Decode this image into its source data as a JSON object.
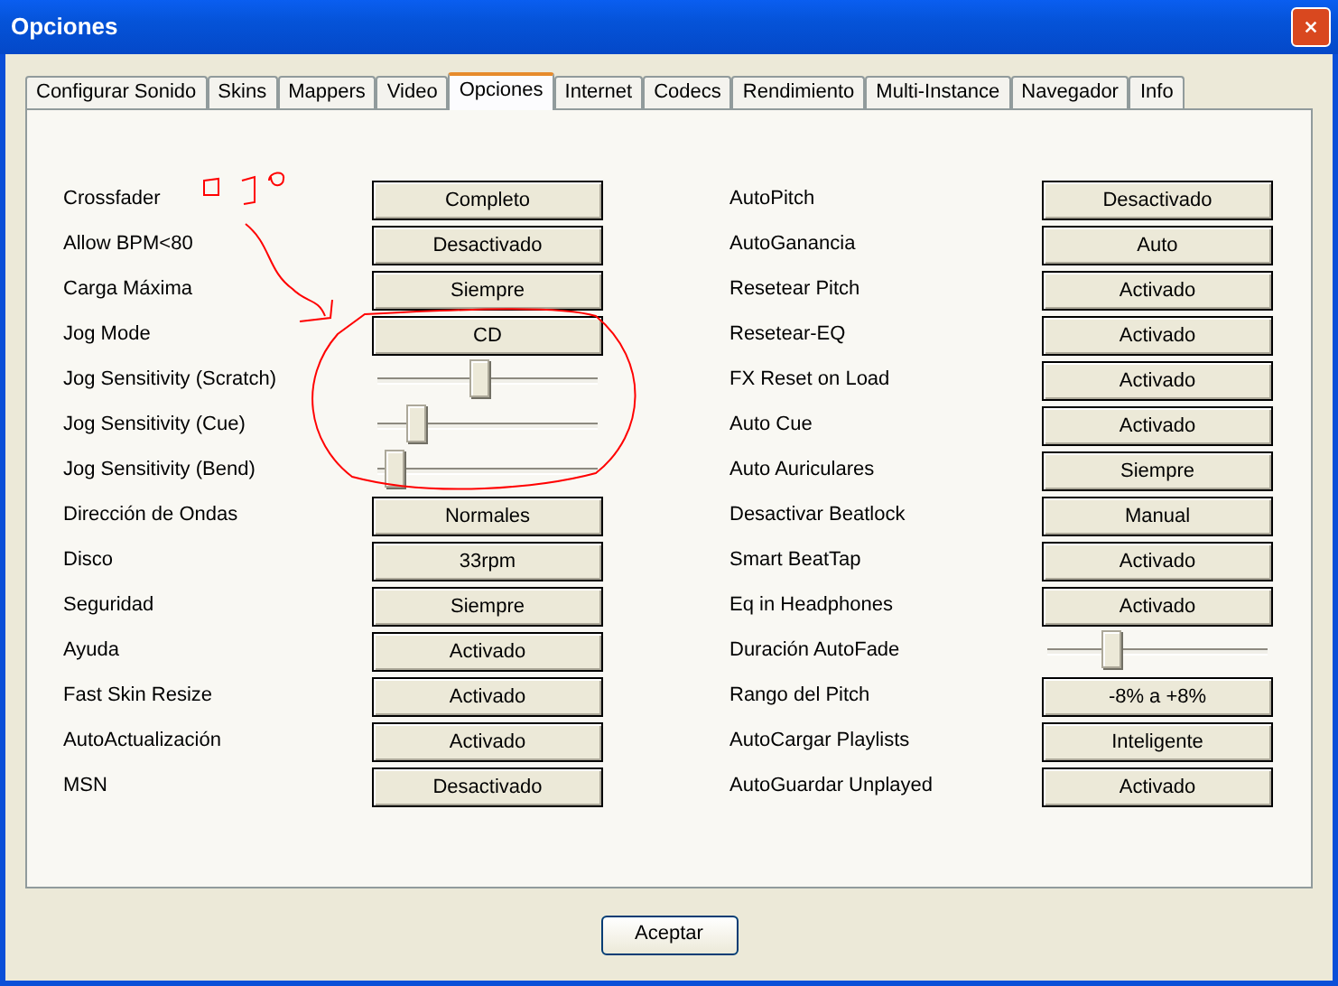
{
  "window": {
    "title": "Opciones"
  },
  "tabs": [
    {
      "label": "Configurar Sonido",
      "selected": false
    },
    {
      "label": "Skins",
      "selected": false
    },
    {
      "label": "Mappers",
      "selected": false
    },
    {
      "label": "Video",
      "selected": false
    },
    {
      "label": "Opciones",
      "selected": true
    },
    {
      "label": "Internet",
      "selected": false
    },
    {
      "label": "Codecs",
      "selected": false
    },
    {
      "label": "Rendimiento",
      "selected": false
    },
    {
      "label": "Multi-Instance",
      "selected": false
    },
    {
      "label": "Navegador",
      "selected": false
    },
    {
      "label": "Info",
      "selected": false
    }
  ],
  "left_settings": [
    {
      "kind": "select",
      "label": "Crossfader",
      "value": "Completo"
    },
    {
      "kind": "select",
      "label": "Allow BPM<80",
      "value": "Desactivado"
    },
    {
      "kind": "select",
      "label": "Carga Máxima",
      "value": "Siempre"
    },
    {
      "kind": "select",
      "label": "Jog Mode",
      "value": "CD"
    },
    {
      "kind": "slider",
      "label": "Jog Sensitivity (Scratch)",
      "level": 0.46
    },
    {
      "kind": "slider",
      "label": "Jog Sensitivity (Cue)",
      "level": 0.14
    },
    {
      "kind": "slider",
      "label": "Jog Sensitivity (Bend)",
      "level": 0.04
    },
    {
      "kind": "select",
      "label": "Dirección de Ondas",
      "value": "Normales"
    },
    {
      "kind": "select",
      "label": "Disco",
      "value": "33rpm"
    },
    {
      "kind": "select",
      "label": "Seguridad",
      "value": "Siempre"
    },
    {
      "kind": "select",
      "label": "Ayuda",
      "value": "Activado"
    },
    {
      "kind": "select",
      "label": "Fast Skin Resize",
      "value": "Activado"
    },
    {
      "kind": "select",
      "label": "AutoActualización",
      "value": "Activado"
    },
    {
      "kind": "select",
      "label": "MSN",
      "value": "Desactivado"
    }
  ],
  "right_settings": [
    {
      "kind": "select",
      "label": "AutoPitch",
      "value": "Desactivado"
    },
    {
      "kind": "select",
      "label": "AutoGanancia",
      "value": "Auto"
    },
    {
      "kind": "select",
      "label": "Resetear Pitch",
      "value": "Activado"
    },
    {
      "kind": "select",
      "label": "Resetear-EQ",
      "value": "Activado"
    },
    {
      "kind": "select",
      "label": "FX Reset on Load",
      "value": "Activado"
    },
    {
      "kind": "select",
      "label": "Auto Cue",
      "value": "Activado"
    },
    {
      "kind": "select",
      "label": "Auto Auriculares",
      "value": "Siempre"
    },
    {
      "kind": "select",
      "label": "Desactivar Beatlock",
      "value": "Manual"
    },
    {
      "kind": "select",
      "label": "Smart BeatTap",
      "value": "Activado"
    },
    {
      "kind": "select",
      "label": "Eq in Headphones",
      "value": "Activado"
    },
    {
      "kind": "slider",
      "label": "Duración AutoFade",
      "level": 0.27
    },
    {
      "kind": "select",
      "label": "Rango del Pitch",
      "value": "-8% a +8%"
    },
    {
      "kind": "select",
      "label": "AutoCargar Playlists",
      "value": "Inteligente"
    },
    {
      "kind": "select",
      "label": "AutoGuardar Unplayed",
      "value": "Activado"
    }
  ],
  "buttons": [
    "Aceptar"
  ]
}
